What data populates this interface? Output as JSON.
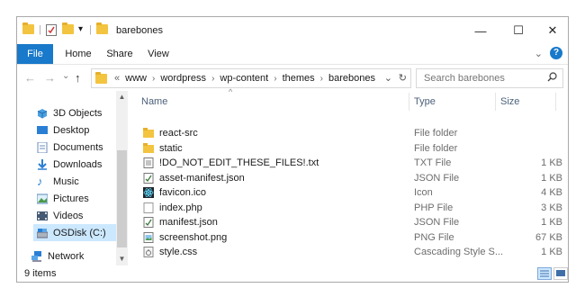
{
  "window": {
    "title": "barebones",
    "controls": {
      "minimize": "—",
      "maximize": "☐",
      "close": "✕"
    }
  },
  "ribbon": {
    "tabs": [
      "File",
      "Home",
      "Share",
      "View"
    ],
    "help": "?"
  },
  "address": {
    "back": "←",
    "forward": "→",
    "recent": "⌄",
    "up": "↑",
    "overflow": "«",
    "crumbs": [
      "www",
      "wordpress",
      "wp-content",
      "themes",
      "barebones"
    ],
    "dropdown": "⌄",
    "refresh": "↻"
  },
  "search": {
    "placeholder": "Search barebones"
  },
  "nav": {
    "items": [
      {
        "label": "3D Objects",
        "icon": "3d-objects-icon"
      },
      {
        "label": "Desktop",
        "icon": "desktop-icon"
      },
      {
        "label": "Documents",
        "icon": "documents-icon"
      },
      {
        "label": "Downloads",
        "icon": "downloads-icon"
      },
      {
        "label": "Music",
        "icon": "music-icon"
      },
      {
        "label": "Pictures",
        "icon": "pictures-icon"
      },
      {
        "label": "Videos",
        "icon": "videos-icon"
      },
      {
        "label": "OSDisk (C:)",
        "icon": "drive-icon",
        "selected": true
      },
      {
        "label": "Network",
        "icon": "network-icon"
      }
    ]
  },
  "columns": {
    "name": "Name",
    "type": "Type",
    "size": "Size"
  },
  "files": [
    {
      "name": "react-src",
      "type": "File folder",
      "size": "",
      "icon": "folder-icon"
    },
    {
      "name": "static",
      "type": "File folder",
      "size": "",
      "icon": "folder-icon"
    },
    {
      "name": "!DO_NOT_EDIT_THESE_FILES!.txt",
      "type": "TXT File",
      "size": "1 KB",
      "icon": "text-file-icon"
    },
    {
      "name": "asset-manifest.json",
      "type": "JSON File",
      "size": "1 KB",
      "icon": "json-file-icon"
    },
    {
      "name": "favicon.ico",
      "type": "Icon",
      "size": "4 KB",
      "icon": "react-icon"
    },
    {
      "name": "index.php",
      "type": "PHP File",
      "size": "3 KB",
      "icon": "blank-file-icon"
    },
    {
      "name": "manifest.json",
      "type": "JSON File",
      "size": "1 KB",
      "icon": "json-file-icon"
    },
    {
      "name": "screenshot.png",
      "type": "PNG File",
      "size": "67 KB",
      "icon": "image-file-icon"
    },
    {
      "name": "style.css",
      "type": "Cascading Style S...",
      "size": "1 KB",
      "icon": "css-file-icon"
    }
  ],
  "status": {
    "item_count": "9 items"
  }
}
